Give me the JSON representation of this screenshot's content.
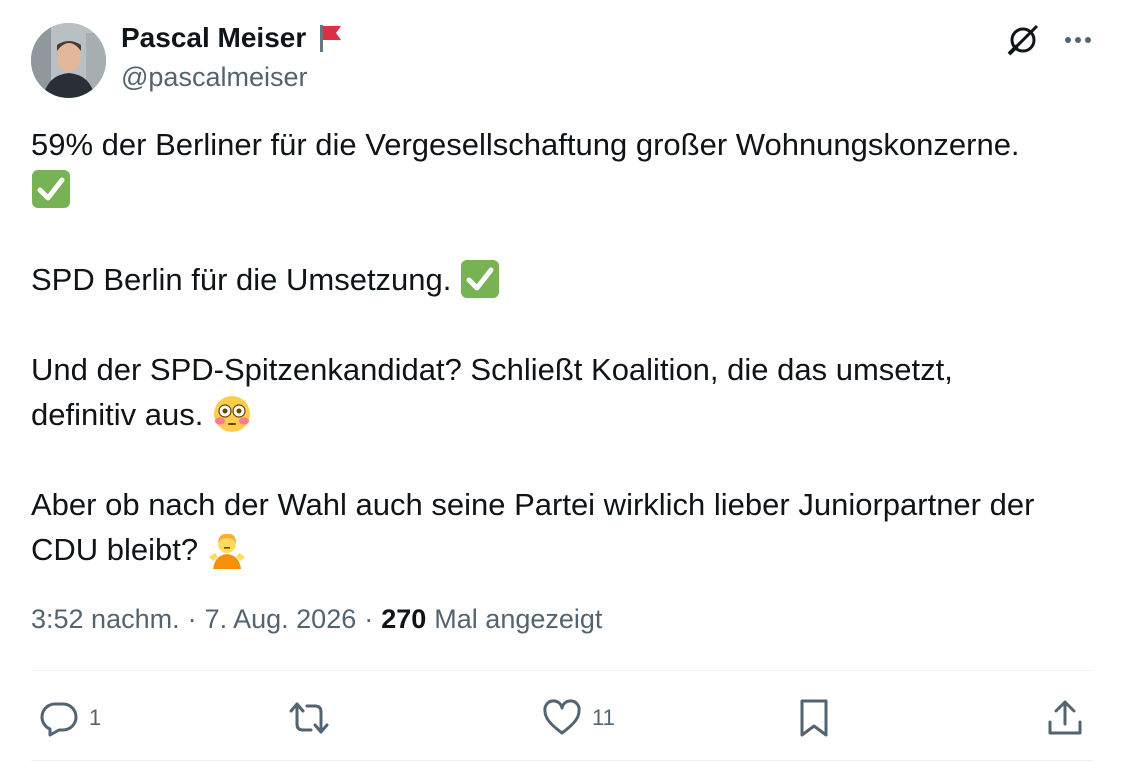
{
  "author": {
    "name": "Pascal Meiser",
    "handle": "@pascalmeiser",
    "avatar_icon": "person-photo",
    "badge_icon": "red-flag-emoji"
  },
  "header_icons": [
    "grok-icon",
    "more-dots-icon"
  ],
  "tweet": {
    "lines": [
      "59% der Berliner für die Vergesellschaftung großer Wohnungskonzerne.",
      "SPD Berlin für die Umsetzung.",
      "Und der SPD-Spitzenkandidat? Schließt Koalition, die das umsetzt,",
      "definitiv aus.",
      "Aber ob nach der Wahl auch seine Partei wirklich lieber Juniorpartner der",
      "CDU bleibt?"
    ],
    "emojis": [
      "check-mark-button",
      "check-mark-button",
      "flushed-face",
      "person-shrugging"
    ]
  },
  "meta": {
    "time": "3:52 nachm.",
    "separator": "·",
    "date": "7. Aug. 2026",
    "views_count": "270",
    "views_label": "Mal angezeigt"
  },
  "actions": {
    "reply_count": "1",
    "retweet_count": "",
    "like_count": "11"
  },
  "colors": {
    "text": "#0f1419",
    "secondary": "#536471",
    "divider": "#eff3f4",
    "check_green": "#4ebf3f",
    "flag_red": "#dd2e44"
  }
}
